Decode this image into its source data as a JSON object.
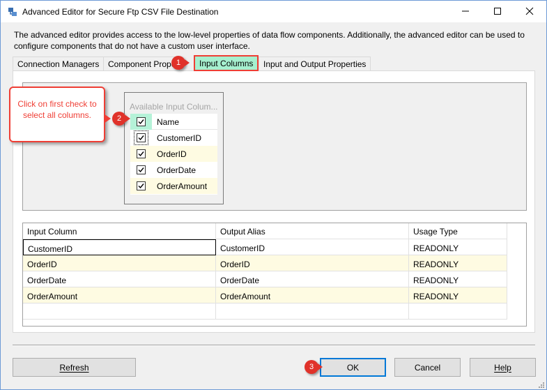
{
  "window": {
    "title": "Advanced Editor for Secure Ftp CSV File Destination",
    "controls": [
      "minimize-icon",
      "maximize-icon",
      "close-icon"
    ]
  },
  "intro_text": "The advanced editor provides access to the low-level properties of data flow components. Additionally, the advanced editor can be used to configure components that do not have a custom user interface.",
  "tabs": [
    {
      "label": "Connection Managers",
      "active": false
    },
    {
      "label": "Component Prope",
      "active": false
    },
    {
      "label": "Input Columns",
      "active": true
    },
    {
      "label": "Input and Output Properties",
      "active": false
    }
  ],
  "available_columns": {
    "title": "Available Input Colum...",
    "header_label": "Name",
    "header_checked": true,
    "items": [
      {
        "label": "CustomerID",
        "checked": true
      },
      {
        "label": "OrderID",
        "checked": true
      },
      {
        "label": "OrderDate",
        "checked": true
      },
      {
        "label": "OrderAmount",
        "checked": true
      }
    ]
  },
  "mapping_grid": {
    "headers": [
      "Input Column",
      "Output Alias",
      "Usage Type"
    ],
    "rows": [
      {
        "input": "CustomerID",
        "alias": "CustomerID",
        "usage": "READONLY"
      },
      {
        "input": "OrderID",
        "alias": "OrderID",
        "usage": "READONLY"
      },
      {
        "input": "OrderDate",
        "alias": "OrderDate",
        "usage": "READONLY"
      },
      {
        "input": "OrderAmount",
        "alias": "OrderAmount",
        "usage": "READONLY"
      }
    ]
  },
  "annotations": {
    "callout_text": "Click on first check to select all columns.",
    "step1": "1",
    "step2": "2",
    "step3": "3"
  },
  "buttons": {
    "refresh": "Refresh",
    "ok": "OK",
    "cancel": "Cancel",
    "help": "Help"
  },
  "colors": {
    "accent": "#0078d7",
    "annotation": "#ef3e35",
    "highlight": "#a6f0cf",
    "alt_row": "#fefbe2"
  }
}
